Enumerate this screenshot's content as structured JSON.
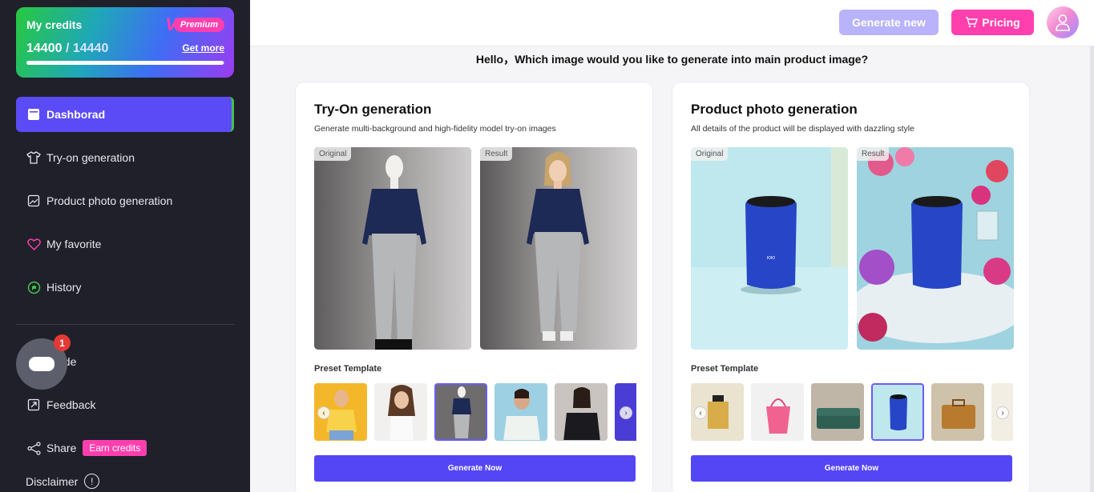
{
  "credits": {
    "title": "My credits",
    "badge_letter": "V",
    "badge_label": "Premium",
    "current": "14400",
    "separator": " / ",
    "total": "14440",
    "get_more": "Get more",
    "progress_fraction": 0.997
  },
  "sidebar": {
    "items": [
      {
        "label": "Dashborad",
        "icon": "dashboard-icon"
      },
      {
        "label": "Try-on generation",
        "icon": "tshirt-icon"
      },
      {
        "label": "Product photo generation",
        "icon": "photo-icon"
      },
      {
        "label": "My favorite",
        "icon": "heart-icon"
      },
      {
        "label": "History",
        "icon": "history-icon"
      },
      {
        "label": "Guide",
        "icon": "guide-icon"
      },
      {
        "label": "Feedback",
        "icon": "feedback-icon"
      },
      {
        "label": "Share",
        "icon": "share-icon"
      }
    ],
    "earn_credits": "Earn credits",
    "disclaimer": "Disclaimer",
    "disclaimer_icon": "!",
    "chat_badge": "1"
  },
  "header": {
    "generate_new": "Generate new",
    "pricing": "Pricing"
  },
  "main": {
    "greeting": "Hello，Which image would you like to generate into main product image?",
    "cards": [
      {
        "title": "Try-On generation",
        "subtitle": "Generate multi-background and high-fidelity model try-on images",
        "original_tag": "Original",
        "result_tag": "Result",
        "preset_label": "Preset Template",
        "button": "Generate Now"
      },
      {
        "title": "Product photo generation",
        "subtitle": "All details of the product will be displayed with dazzling style",
        "original_tag": "Original",
        "result_tag": "Result",
        "preset_label": "Preset Template",
        "button": "Generate Now"
      }
    ]
  },
  "colors": {
    "sidebar_bg": "#1f2029",
    "accent": "#5446f5",
    "pink": "#ff3fae",
    "active_nav": "#5b4bf6"
  }
}
